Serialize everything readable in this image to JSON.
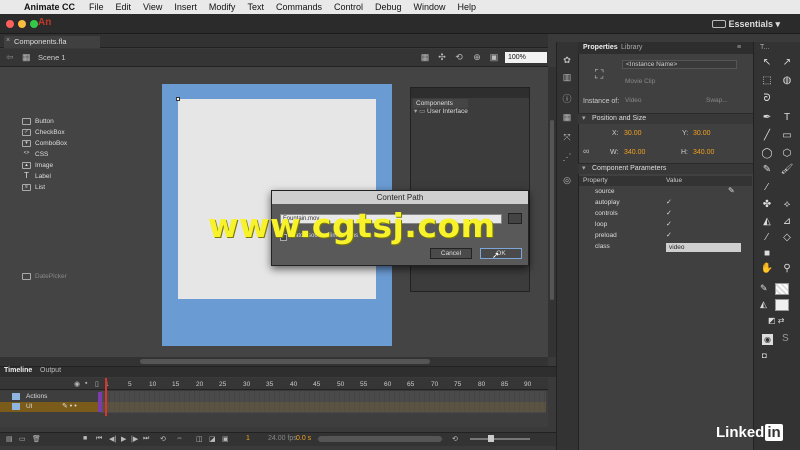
{
  "menubar": {
    "app_name": "Animate CC",
    "items": [
      "File",
      "Edit",
      "View",
      "Insert",
      "Modify",
      "Text",
      "Commands",
      "Control",
      "Debug",
      "Window",
      "Help"
    ]
  },
  "titlebar": {
    "logo": "An",
    "workspace": "Essentials ▾"
  },
  "document": {
    "tab": "Components.fla (Canvas)*",
    "scene": "Scene 1",
    "zoom": "100%"
  },
  "components_panel": {
    "tab": "Components",
    "folder": "User Interface",
    "items": [
      "Button",
      "CheckBox",
      "ComboBox",
      "CSS",
      "Image",
      "Label",
      "List",
      "DatePicker"
    ]
  },
  "dialog": {
    "title": "Content Path",
    "path_value": "Fountain.mov",
    "checkbox_label": "Match source dimensions",
    "cancel": "Cancel",
    "ok": "OK"
  },
  "watermark": "www.cgtsj.com",
  "timeline": {
    "tab1": "Timeline",
    "tab2": "Output",
    "ruler": [
      "1",
      "5",
      "10",
      "15",
      "20",
      "25",
      "30",
      "35",
      "40",
      "45",
      "50",
      "55",
      "60",
      "65",
      "70",
      "75",
      "80",
      "85",
      "90"
    ],
    "layers": [
      "Actions",
      "UI"
    ],
    "frame": "1",
    "fps": "24.00 fps",
    "time": "0.0 s"
  },
  "properties": {
    "tab1": "Properties",
    "tab2": "Library",
    "instance_name_placeholder": "<Instance Name>",
    "symbol_type": "Movie Clip",
    "instance_of_label": "Instance of:",
    "instance_of": "Video",
    "swap": "Swap...",
    "pos_section": "Position and Size",
    "x_label": "X:",
    "x": "30.00",
    "y_label": "Y:",
    "y": "30.00",
    "w_label": "W:",
    "w": "340.00",
    "h_label": "H:",
    "h": "340.00",
    "params_section": "Component Parameters",
    "col_property": "Property",
    "col_value": "Value",
    "params": [
      {
        "name": "source",
        "value": ""
      },
      {
        "name": "autoplay",
        "value": "✓"
      },
      {
        "name": "controls",
        "value": "✓"
      },
      {
        "name": "loop",
        "value": "✓"
      },
      {
        "name": "preload",
        "value": "✓"
      },
      {
        "name": "class",
        "value": "video"
      }
    ]
  },
  "branding": {
    "linkedin": "Linked",
    "in": "in"
  }
}
